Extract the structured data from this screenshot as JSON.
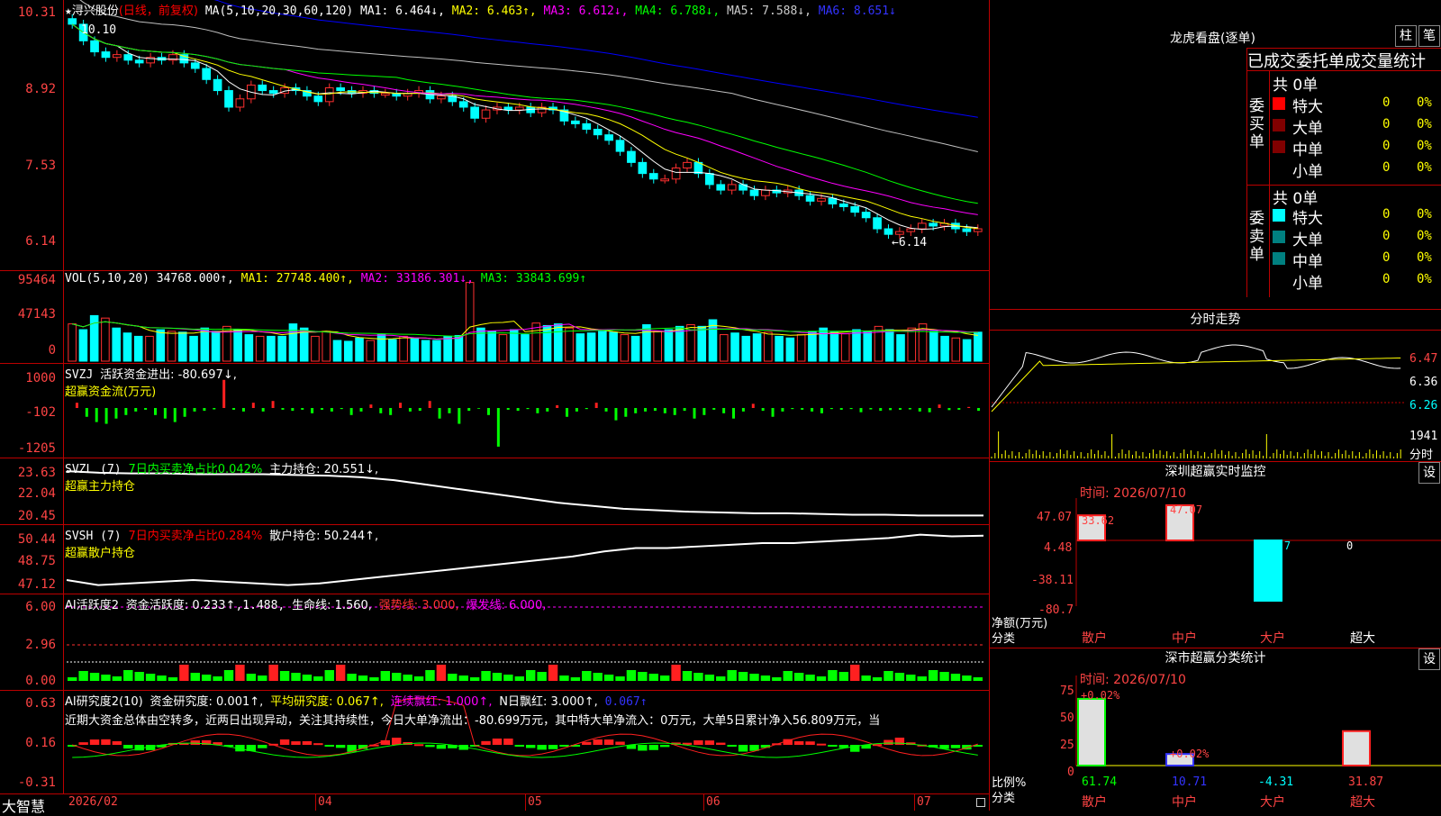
{
  "main_chart": {
    "title_star": "★",
    "stock_name": "浔兴股份",
    "period": "(日线，前复权)",
    "ma_header": "MA(5,10,20,30,60,120)",
    "ma1": "MA1: 6.464↓,",
    "ma2": "MA2: 6.463↑,",
    "ma3": "MA3: 6.612↓,",
    "ma4": "MA4: 6.788↓,",
    "ma5": "MA5: 7.588↓,",
    "ma6": "MA6: 8.651↓",
    "y_ticks": [
      "10.31",
      "8.92",
      "7.53",
      "6.14"
    ],
    "high_label": "10.10",
    "low_label": "←6.14",
    "chart_data": {
      "type": "candlestick",
      "y_range": [
        6.14,
        10.31
      ],
      "ma_colors": {
        "ma1": "#ffffff",
        "ma2": "#ffff00",
        "ma3": "#ff00ff",
        "ma4": "#00ff00",
        "ma5": "#c0c0c0",
        "ma6": "#0000ff"
      },
      "close_series": [
        10.1,
        9.8,
        9.6,
        9.5,
        9.55,
        9.45,
        9.4,
        9.5,
        9.45,
        9.55,
        9.4,
        9.3,
        9.1,
        8.9,
        8.6,
        8.75,
        9.0,
        8.9,
        8.85,
        8.95,
        8.9,
        8.8,
        8.7,
        8.95,
        8.9,
        8.85,
        8.9,
        8.85,
        8.85,
        8.8,
        8.85,
        8.9,
        8.75,
        8.8,
        8.7,
        8.6,
        8.4,
        8.55,
        8.6,
        8.55,
        8.6,
        8.5,
        8.6,
        8.55,
        8.35,
        8.3,
        8.2,
        8.1,
        8.0,
        7.8,
        7.6,
        7.4,
        7.3,
        7.3,
        7.5,
        7.6,
        7.4,
        7.2,
        7.1,
        7.2,
        7.1,
        7.0,
        7.1,
        7.05,
        7.1,
        7.0,
        6.9,
        6.95,
        6.85,
        6.8,
        6.7,
        6.6,
        6.4,
        6.3,
        6.35,
        6.4,
        6.5,
        6.45,
        6.5,
        6.4,
        6.35,
        6.4
      ]
    }
  },
  "vol_chart": {
    "header": "VOL(5,10,20)",
    "vol": "34768.000↑,",
    "ma1": "MA1: 27748.400↑,",
    "ma2": "MA2: 33186.301↓,",
    "ma3": "MA3: 33843.699↑",
    "y_ticks": [
      "95464",
      "47143",
      "0"
    ],
    "chart_data": {
      "type": "bar",
      "ylim": [
        0,
        95464
      ],
      "values": [
        45,
        38,
        55,
        52,
        40,
        34,
        30,
        30,
        38,
        36,
        35,
        30,
        40,
        36,
        42,
        38,
        32,
        30,
        30,
        30,
        45,
        40,
        30,
        36,
        25,
        24,
        28,
        25,
        32,
        26,
        30,
        27,
        25,
        25,
        30,
        31,
        95,
        40,
        36,
        32,
        38,
        32,
        46,
        43,
        45,
        40,
        33,
        34,
        36,
        35,
        32,
        30,
        44,
        36,
        38,
        42,
        44,
        42,
        50,
        32,
        34,
        30,
        33,
        35,
        30,
        28,
        32,
        36,
        40,
        35,
        33,
        38,
        36,
        42,
        38,
        32,
        40,
        45,
        36,
        30,
        28,
        26,
        35
      ],
      "up_days": [
        0,
        3,
        7,
        9,
        14,
        17,
        22,
        23,
        27,
        30,
        36,
        39,
        42,
        45,
        50,
        53,
        56,
        59,
        63,
        66,
        70,
        73,
        76,
        77,
        80
      ]
    }
  },
  "svzj": {
    "header": "SVZJ",
    "label": "活跃资金进出: -80.697↓,",
    "sub": "超赢资金流(万元)",
    "y_ticks": [
      "1000",
      "-102",
      "-1205"
    ],
    "chart_data": {
      "type": "bar",
      "ylim": [
        -1205,
        1000
      ],
      "values": [
        150,
        -250,
        -400,
        -450,
        -300,
        -200,
        -100,
        -50,
        -200,
        -300,
        -400,
        -250,
        -100,
        -80,
        -40,
        800,
        -50,
        -100,
        150,
        -100,
        200,
        -50,
        -80,
        -50,
        -150,
        -50,
        -100,
        -30,
        -200,
        -100,
        100,
        -150,
        -200,
        150,
        -100,
        -80,
        200,
        -300,
        -150,
        -450,
        -80,
        -20,
        -200,
        -1100,
        -50,
        -80,
        -30,
        -150,
        -100,
        80,
        -250,
        -100,
        -30,
        150,
        -100,
        -350,
        -250,
        -150,
        -100,
        -80,
        -150,
        -200,
        -80,
        -300,
        -200,
        -50,
        -150,
        -300,
        -100,
        120,
        -80,
        -250,
        -100,
        -30,
        -50,
        -100,
        -150,
        -30,
        -50,
        -30,
        -120,
        -40,
        -80,
        -60,
        -50,
        -40,
        -100,
        -120,
        100,
        -60,
        -50,
        30,
        -80
      ]
    }
  },
  "svzl": {
    "header": "SVZL (7)",
    "ratio": "7日内买卖净占比0.042%",
    "hold": "主力持仓: 20.551↓,",
    "sub": "超赢主力持仓",
    "y_ticks": [
      "23.63",
      "22.04",
      "20.45"
    ],
    "chart_data": {
      "type": "line",
      "ylim": [
        20.45,
        23.63
      ],
      "values": [
        23.5,
        23.4,
        23.35,
        23.35,
        23.3,
        23.3,
        23.3,
        23.25,
        23.2,
        23.1,
        22.9,
        22.6,
        22.3,
        22.0,
        21.7,
        21.4,
        21.2,
        21.0,
        20.9,
        20.8,
        20.75,
        20.7,
        20.7,
        20.65,
        20.6,
        20.6,
        20.55,
        20.55,
        20.55
      ]
    }
  },
  "svsh": {
    "header": "SVSH (7)",
    "ratio": "7日内买卖净占比0.284%",
    "hold": "散户持仓: 50.244↑,",
    "sub": "超赢散户持仓",
    "y_ticks": [
      "50.44",
      "48.75",
      "47.12"
    ],
    "chart_data": {
      "type": "line",
      "ylim": [
        47.12,
        50.44
      ],
      "values": [
        47.6,
        47.3,
        47.4,
        47.5,
        47.6,
        47.5,
        47.4,
        47.3,
        47.4,
        47.6,
        47.8,
        48.0,
        48.2,
        48.4,
        48.6,
        48.8,
        49.0,
        49.3,
        49.5,
        49.5,
        49.6,
        49.7,
        49.8,
        49.8,
        49.9,
        50.0,
        50.1,
        50.3,
        50.2,
        50.24
      ]
    }
  },
  "ai_active": {
    "header": "AI活跃度2",
    "fund": "资金活跃度: 0.233↑",
    "val2": ",1.488,",
    "life": "生命线: 1.560,",
    "strong": "强势线: 3.000,",
    "burst": "爆发线: 6.000,",
    "y_ticks": [
      "6.00",
      "2.96",
      "0.00"
    ]
  },
  "ai_research": {
    "header": "AI研究度2(10)",
    "fund": "资金研究度: 0.001↑,",
    "avg": "平均研究度: 0.067↑,",
    "cont": "连续飘红: 1.000↑,",
    "nday": "N日飘红: 3.000↑,",
    "last": "0.067↑",
    "comment": "近期大资金总体由空转多，近两日出现异动，关注其持续性，今日大单净流出：-80.699万元，其中特大单净流入：0万元，大单5日累计净入56.809万元，当",
    "y_ticks": [
      "0.63",
      "0.16",
      "-0.31"
    ]
  },
  "x_axis": {
    "brand": "大智慧",
    "labels": [
      "2026/02",
      "04",
      "05",
      "06",
      "07"
    ]
  },
  "dragon": {
    "title": "龙虎看盘(逐单)",
    "btn1": "柱",
    "btn2": "笔",
    "tabs": "已成交委托单成交量统计",
    "buy_label": "委买单",
    "sell_label": "委卖单",
    "buy_total": "共 0单",
    "sell_total": "共 0单",
    "rows": [
      {
        "name": "特大",
        "count": "0",
        "pct": "0%"
      },
      {
        "name": "大单",
        "count": "0",
        "pct": "0%"
      },
      {
        "name": "中单",
        "count": "0",
        "pct": "0%"
      },
      {
        "name": "小单",
        "count": "0",
        "pct": "0%"
      }
    ],
    "buy_colors": [
      "#ff0000",
      "#800000",
      "#800000",
      "#000000"
    ],
    "sell_colors": [
      "#00ffff",
      "#008080",
      "#008080",
      "#000000"
    ]
  },
  "intraday": {
    "title": "分时走势",
    "y_ticks": [
      "6.47",
      "6.36",
      "6.26"
    ],
    "vol_label": "1941",
    "vol_unit": "分时"
  },
  "monitor": {
    "title": "深圳超赢实时监控",
    "btn": "设",
    "time": "时间: 2026/07/10",
    "y_ticks": [
      "47.07",
      "4.48",
      "-38.11",
      "-80.7"
    ],
    "unit1": "净额(万元)",
    "unit2": "分类",
    "categories": [
      "散户",
      "中户",
      "大户",
      "超大"
    ],
    "values": [
      33.62,
      47.07,
      -80.7,
      0
    ],
    "value_labels": [
      "33.62",
      "47.07",
      "-80.7",
      "0"
    ]
  },
  "classify": {
    "title": "深市超赢分类统计",
    "btn": "设",
    "time": "时间: 2026/07/10",
    "y_ticks": [
      "75",
      "50",
      "25",
      "0"
    ],
    "unit1": "比例%",
    "unit2": "分类",
    "categories": [
      "散户",
      "中户",
      "大户",
      "超大"
    ],
    "values": [
      61.74,
      10.71,
      -4.31,
      31.87
    ],
    "value_labels": [
      "61.74",
      "10.71",
      "-4.31",
      "31.87"
    ],
    "delta_labels": [
      "+0.02%",
      "+0.02%"
    ]
  }
}
